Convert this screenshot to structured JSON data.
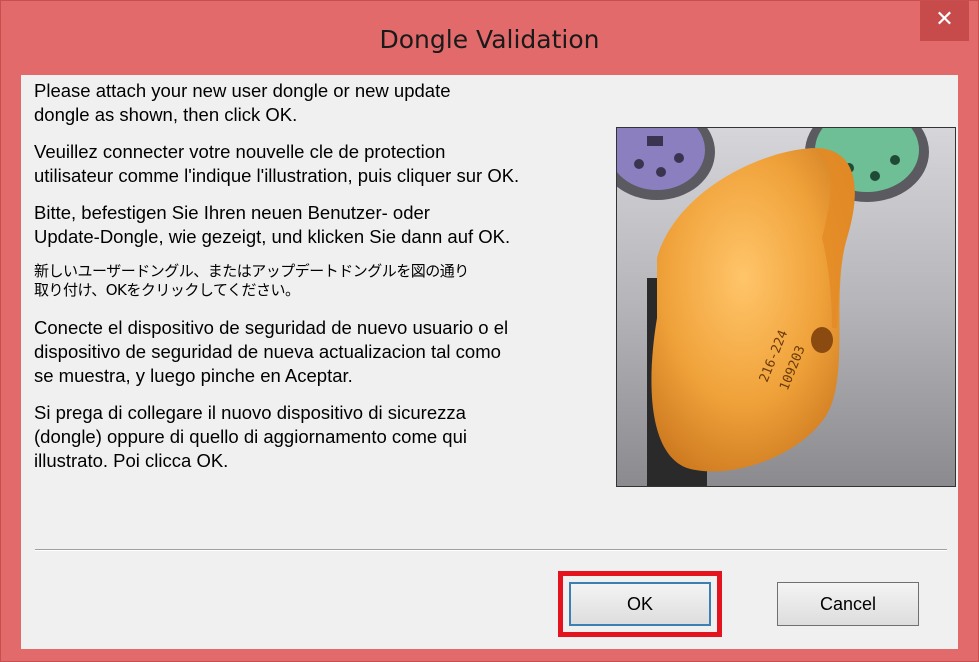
{
  "window": {
    "title": "Dongle Validation",
    "close_label": "✕"
  },
  "messages": [
    "Please attach your new user dongle or new update\ndongle as shown, then click OK.",
    "Veuillez connecter votre nouvelle cle de protection\nutilisateur comme l'indique l'illustration, puis cliquer sur OK.",
    "Bitte, befestigen Sie Ihren neuen Benutzer- oder\nUpdate-Dongle, wie gezeigt, und klicken Sie dann auf OK.",
    "新しいユーザードングル、またはアップデートドングルを図の通り\n取り付け、OKをクリックしてください。",
    "Conecte el dispositivo de seguridad de nuevo usuario o el\ndispositivo de seguridad de nueva actualizacion tal como\nse muestra, y luego pinche en Aceptar.",
    "Si prega di collegare il nuovo dispositivo di sicurezza\n(dongle) oppure di quello di aggiornamento come qui\nillustrato. Poi clicca OK."
  ],
  "illustration": {
    "dongle_label_line1": "216-224",
    "dongle_label_line2": "109203"
  },
  "buttons": {
    "ok_label": "OK",
    "cancel_label": "Cancel"
  },
  "colors": {
    "titlebar": "#e26a6a",
    "close_button": "#c74b4b",
    "highlight": "#e3141e",
    "dongle": "#f0a23a"
  }
}
